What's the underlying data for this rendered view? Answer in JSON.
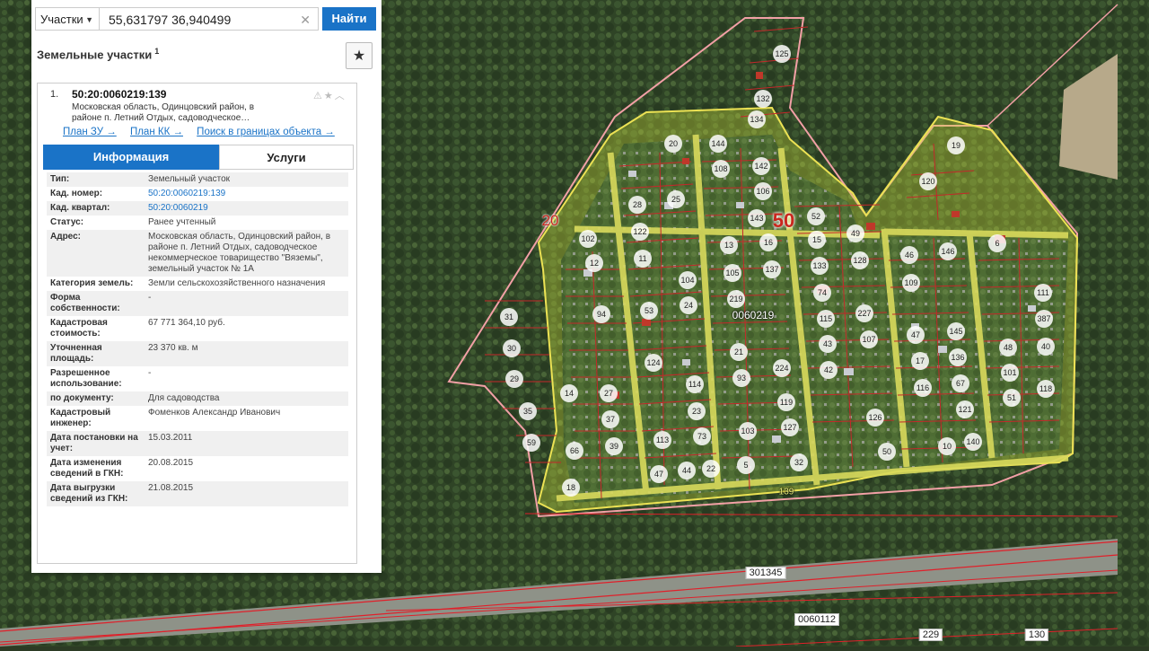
{
  "search": {
    "type_label": "Участки",
    "query": "55,631797 36,940499",
    "button_label": "Найти"
  },
  "panel": {
    "title": "Земельные участки",
    "title_count": "1",
    "card": {
      "index": "1.",
      "cad_id": "50:20:0060219:139",
      "address_short": "Московская область, Одинцовский район, в районе п. Летний Отдых, садоводческое…",
      "links": [
        "План ЗУ →",
        "План КК →",
        "Поиск в границах объекта →"
      ],
      "tabs": [
        "Информация",
        "Услуги"
      ],
      "active_tab": "Информация",
      "info": [
        {
          "key": "Тип:",
          "value": "Земельный участок"
        },
        {
          "key": "Кад. номер:",
          "value": "50:20:0060219:139",
          "link": true
        },
        {
          "key": "Кад. квартал:",
          "value": "50:20:0060219",
          "link": true
        },
        {
          "key": "Статус:",
          "value": "Ранее учтенный"
        },
        {
          "key": "Адрес:",
          "value": "Московская область, Одинцовский район, в районе п. Летний Отдых, садоводческое некоммерческое товарищество \"Вяземы\", земельный участок № 1А"
        },
        {
          "key": "Категория земель:",
          "value": "Земли сельскохозяйственного назначения"
        },
        {
          "key": "Форма собственности:",
          "value": "-"
        },
        {
          "key": "Кадастровая стоимость:",
          "value": "67 771 364,10 руб."
        },
        {
          "key": "Уточненная площадь:",
          "value": "23 370 кв. м"
        },
        {
          "key": "Разрешенное использование:",
          "value": "-"
        },
        {
          "key": "по документу:",
          "value": "Для садоводства"
        },
        {
          "key": "Кадастровый инженер:",
          "value": "Фоменков Александр Иванович"
        },
        {
          "key": "Дата постановки на учет:",
          "value": "15.03.2011"
        },
        {
          "key": "Дата изменения сведений в ГКН:",
          "value": "20.08.2015"
        },
        {
          "key": "Дата выгрузки сведений из ГКН:",
          "value": "21.08.2015"
        }
      ]
    }
  },
  "map": {
    "big_labels": [
      {
        "text": "50",
        "size": 22
      },
      {
        "text": "20",
        "size": 17
      }
    ],
    "quarter_label": "0060219",
    "selected_label": "139",
    "road_labels": [
      "301345",
      "0060112"
    ],
    "bottom_labels": [
      "229",
      "130"
    ],
    "plot_labels": [
      "125",
      "132",
      "134",
      "20",
      "144",
      "108",
      "142",
      "106",
      "143",
      "52",
      "16",
      "15",
      "49",
      "128",
      "146",
      "6",
      "28",
      "25",
      "122",
      "102",
      "12",
      "11",
      "104",
      "105",
      "137",
      "133",
      "74",
      "46",
      "109",
      "111",
      "387",
      "219",
      "53",
      "24",
      "94",
      "31",
      "30",
      "29",
      "35",
      "59",
      "14",
      "27",
      "37",
      "66",
      "39",
      "93",
      "124",
      "114",
      "23",
      "73",
      "113",
      "21",
      "224",
      "119",
      "127",
      "103",
      "5",
      "32",
      "22",
      "44",
      "47",
      "42",
      "43",
      "107",
      "227",
      "115",
      "47",
      "17",
      "116",
      "145",
      "136",
      "67",
      "121",
      "48",
      "101",
      "51",
      "40",
      "118",
      "126",
      "50",
      "140",
      "10",
      "19",
      "120",
      "13",
      "18",
      "60"
    ]
  },
  "colors": {
    "accent": "#1a73c7",
    "boundary": "#e0202a",
    "selected_fill": "#d4e33a"
  }
}
